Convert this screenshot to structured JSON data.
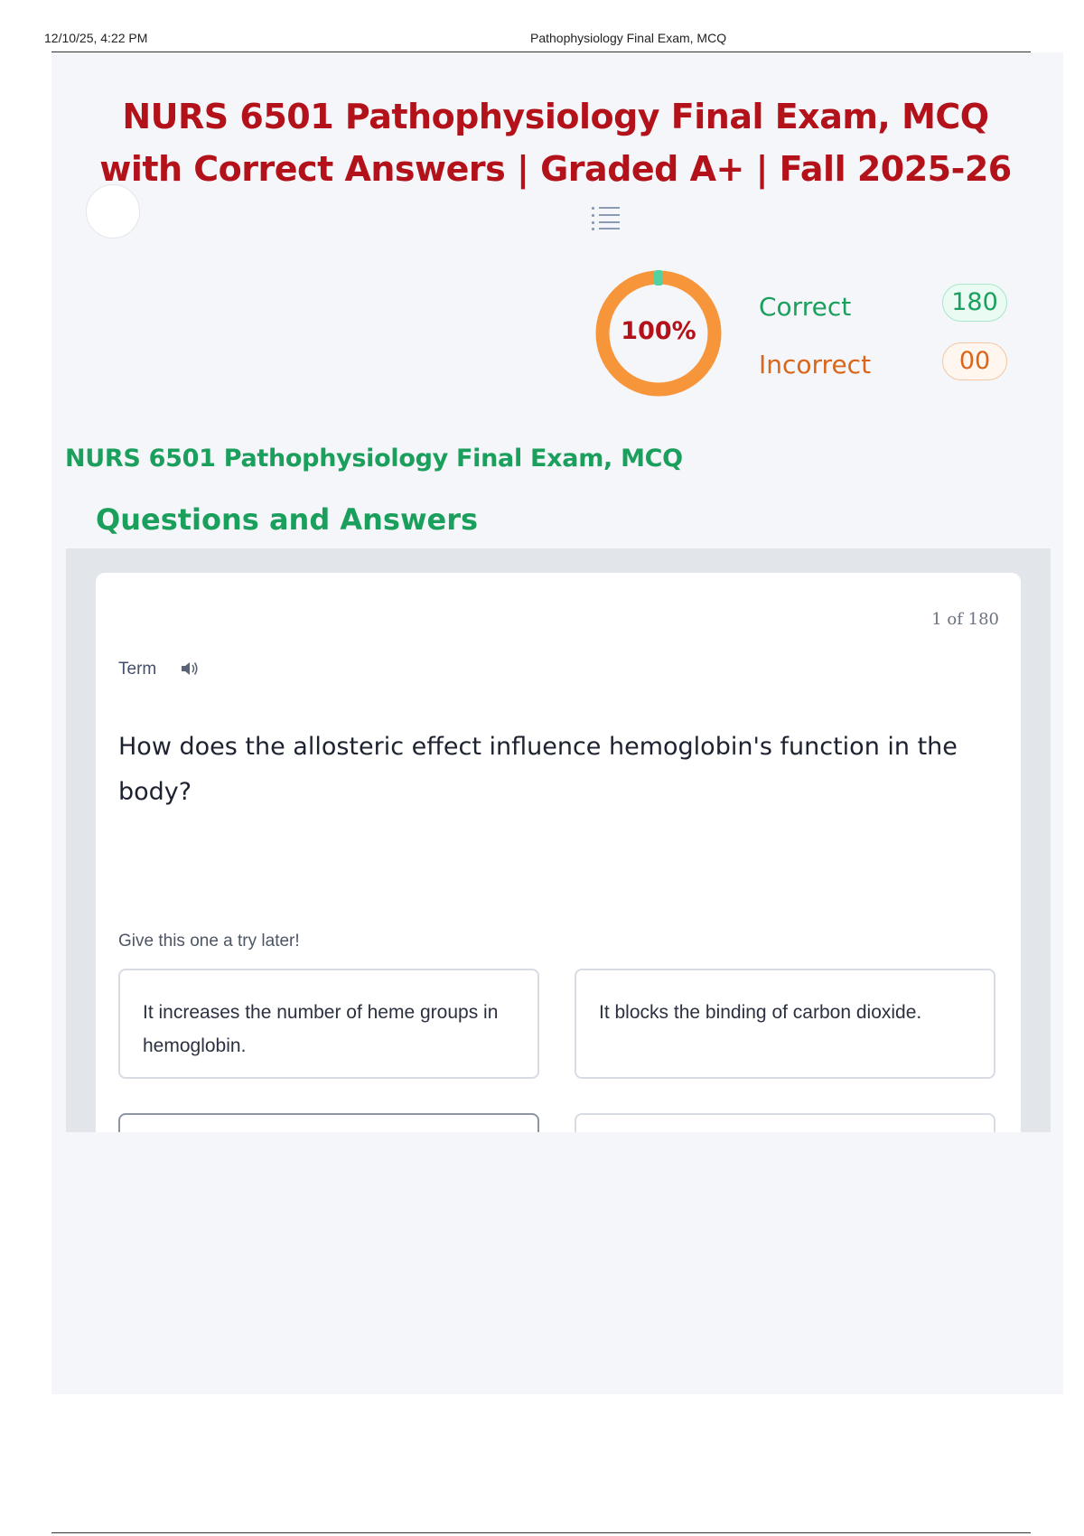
{
  "print_header": {
    "datetime": "12/10/25, 4:22 PM",
    "page_title": "Pathophysiology Final Exam, MCQ"
  },
  "main": {
    "title": "NURS 6501 Pathophysiology Final Exam, MCQ with Correct Answers | Graded A+ | Fall 2025-26",
    "menu_icon": "list-icon",
    "score": {
      "percent_label": "100%",
      "percent_value": 1.0,
      "correct_label": "Correct",
      "correct_count": "180",
      "incorrect_label": "Incorrect",
      "incorrect_count": "00",
      "colors": {
        "correct": "#1a9f5c",
        "incorrect": "#d9661a",
        "ring": "#f7953a",
        "ring_marker": "#54d1a0"
      }
    },
    "section_title": "NURS 6501 Pathophysiology Final Exam, MCQ",
    "section_subtitle": "Questions and Answers"
  },
  "card": {
    "counter": "1 of 180",
    "term_label": "Term",
    "speaker_icon": "speaker-icon",
    "question": "How does the allosteric effect influence hemoglobin's function in the body?",
    "hint": "Give this one a try later!",
    "options": [
      "It increases the number of heme groups in hemoglobin.",
      "It blocks the binding of carbon dioxide."
    ]
  }
}
